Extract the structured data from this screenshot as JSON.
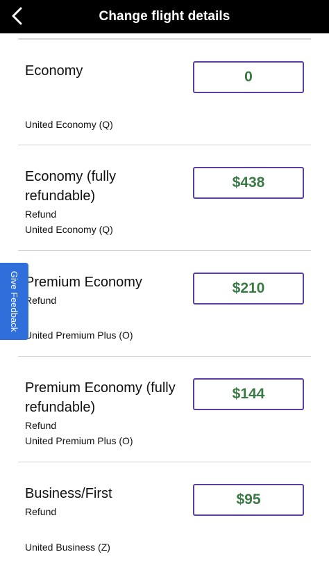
{
  "header": {
    "title": "Change flight details",
    "back_icon": "chevron-left-icon"
  },
  "feedback": {
    "label": "Give Feedback"
  },
  "fares": [
    {
      "name": "Economy",
      "refund_label": "",
      "cabin": "United Economy (Q)",
      "price": "0"
    },
    {
      "name": "Economy (fully refundable)",
      "refund_label": "Refund",
      "cabin": "United Economy (Q)",
      "price": "$438"
    },
    {
      "name": "Premium Economy",
      "refund_label": "Refund",
      "cabin": "United Premium Plus (O)",
      "price": "$210"
    },
    {
      "name": "Premium Economy (fully refundable)",
      "refund_label": "Refund",
      "cabin": "United Premium Plus (O)",
      "price": "$144"
    },
    {
      "name": "Business/First",
      "refund_label": "Refund",
      "cabin": "United Business (Z)",
      "price": "$95"
    }
  ],
  "colors": {
    "header_bg": "#000000",
    "price_text": "#3a7a45",
    "price_border": "#5b3fa0",
    "feedback_bg": "#2f6fdc"
  }
}
